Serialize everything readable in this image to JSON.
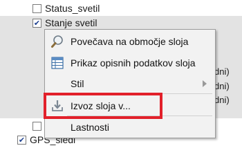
{
  "layers": [
    {
      "label": "Status_svetil",
      "checked": false
    },
    {
      "label": "Stanje svetil",
      "checked": true
    },
    {
      "label": "",
      "checked": false
    },
    {
      "label": "GPS_sledi",
      "checked": true
    }
  ],
  "legend_fragments": [
    "dni)",
    "dni)",
    "dni)"
  ],
  "context_menu": {
    "items": [
      {
        "label": "Povečava na območje sloja",
        "icon": "zoom-to-layer-icon"
      },
      {
        "label": "Prikaz opisnih podatkov sloja",
        "icon": "attribute-table-icon"
      },
      {
        "label": "Stil",
        "icon": "",
        "has_submenu": true
      },
      {
        "label": "Izvoz sloja v...",
        "icon": "export-layer-icon",
        "highlighted": true
      },
      {
        "label": "Lastnosti",
        "icon": ""
      }
    ]
  },
  "colors": {
    "highlight_border": "#e2202a",
    "menu_background": "#f2f2f2",
    "selected_row": "#e3e3e3"
  }
}
